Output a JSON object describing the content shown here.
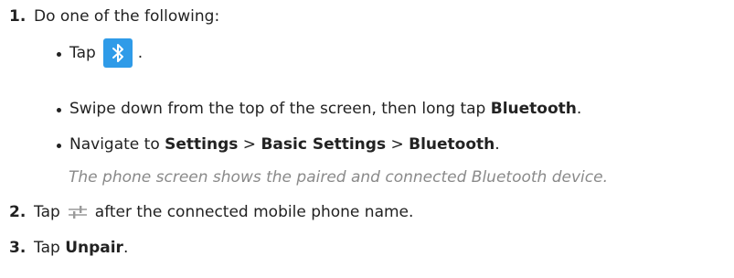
{
  "steps": [
    {
      "number": "1.",
      "text": "Do one of the following:"
    },
    {
      "number": "2.",
      "text_before": "Tap",
      "icon": "slider-settings-icon",
      "text_after": "after the connected mobile phone name."
    },
    {
      "number": "3.",
      "text_before": "Tap",
      "bold": "Unpair",
      "text_after": "."
    }
  ],
  "options": [
    {
      "text_before": "Tap",
      "icon": "bluetooth-icon",
      "text_after": "."
    },
    {
      "text_before": "Swipe down from the top of the screen, then long tap",
      "bold": "Bluetooth",
      "text_after": "."
    },
    {
      "text_before": "Navigate to",
      "bold1": "Settings",
      "sep1": ">",
      "bold2": "Basic Settings",
      "sep2": ">",
      "bold3": "Bluetooth",
      "text_after": "."
    }
  ],
  "note": "The phone screen shows the paired and connected Bluetooth device.",
  "colors": {
    "text": "#222222",
    "note": "#8a8a8a",
    "bluetooth_bg": "#2f9be8",
    "icon_gray": "#9a9a9a"
  }
}
